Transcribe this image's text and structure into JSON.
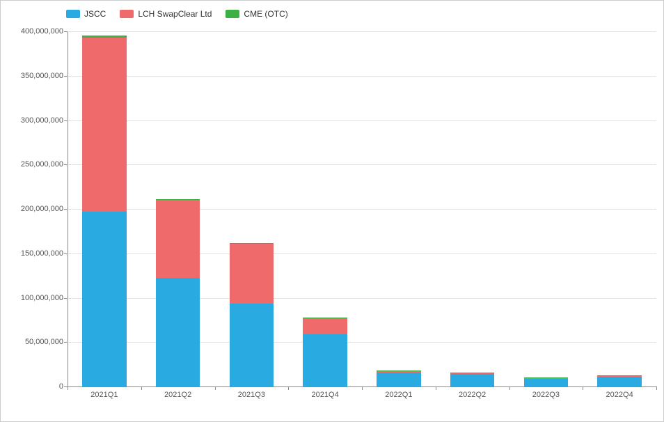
{
  "chart_data": {
    "type": "bar",
    "stacked": true,
    "categories": [
      "2021Q1",
      "2021Q2",
      "2021Q3",
      "2021Q4",
      "2022Q1",
      "2022Q2",
      "2022Q3",
      "2022Q4"
    ],
    "series": [
      {
        "name": "JSCC",
        "color": "#29abe2",
        "values": [
          197000000,
          122000000,
          93000000,
          59000000,
          16000000,
          14000000,
          9000000,
          11000000
        ]
      },
      {
        "name": "LCH SwapClear Ltd",
        "color": "#ef6b6b",
        "values": [
          196000000,
          88000000,
          68000000,
          18000000,
          1000000,
          1000000,
          500000,
          500000
        ]
      },
      {
        "name": "CME (OTC)",
        "color": "#3cb043",
        "values": [
          2000000,
          800000,
          800000,
          500000,
          500000,
          500000,
          300000,
          300000
        ]
      }
    ],
    "y_ticks": [
      0,
      50000000,
      100000000,
      150000000,
      200000000,
      250000000,
      300000000,
      350000000,
      400000000
    ],
    "y_tick_labels": [
      "0",
      "50,000,000",
      "100,000,000",
      "150,000,000",
      "200,000,000",
      "250,000,000",
      "300,000,000",
      "350,000,000",
      "400,000,000"
    ],
    "ylim": [
      0,
      400000000
    ],
    "xlabel": "",
    "ylabel": "",
    "title": ""
  }
}
